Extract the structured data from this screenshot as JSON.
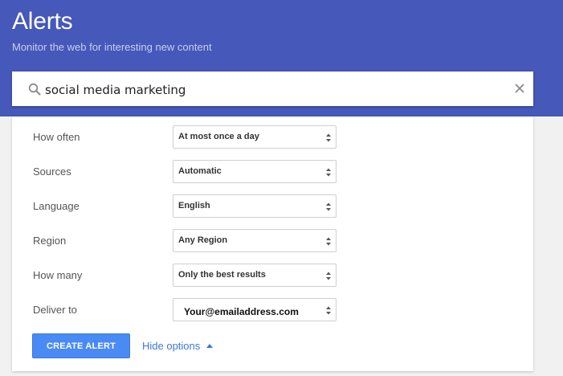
{
  "header": {
    "title": "Alerts",
    "subtitle": "Monitor the web for interesting new content",
    "background_color": "#4658b9"
  },
  "search": {
    "value": "social media marketing",
    "icon": "search-icon",
    "clear_icon": "close-icon"
  },
  "options": [
    {
      "label": "How often",
      "value": "At most once a day"
    },
    {
      "label": "Sources",
      "value": "Automatic"
    },
    {
      "label": "Language",
      "value": "English"
    },
    {
      "label": "Region",
      "value": "Any Region"
    },
    {
      "label": "How many",
      "value": "Only the best results"
    },
    {
      "label": "Deliver to",
      "value": "Your@emailaddress.com"
    }
  ],
  "actions": {
    "create_label": "CREATE ALERT",
    "hide_options_label": "Hide options",
    "accent_color": "#4a8af4"
  }
}
